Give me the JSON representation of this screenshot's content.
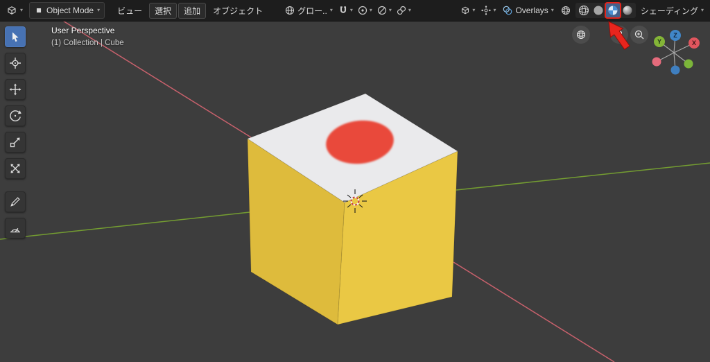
{
  "header": {
    "mode_label": "Object Mode",
    "menus": {
      "view": "ビュー",
      "select": "選択",
      "add": "追加",
      "object": "オブジェクト"
    },
    "orientation_label": "グロー..",
    "overlays_label": "Overlays",
    "shading_label": "シェーディング"
  },
  "viewport": {
    "view_label": "User Perspective",
    "collection_label": "(1) Collection | Cube",
    "axis_labels": {
      "x": "X",
      "y": "Y",
      "z": "Z"
    }
  },
  "tools": [
    "select-box",
    "cursor",
    "move",
    "rotate",
    "scale",
    "transform",
    "annotate",
    "measure"
  ],
  "icons": {
    "chevron": "▾",
    "editor_type": "3d-viewport-cube",
    "snapping": "magnet",
    "proportional": "circle-dot",
    "falloff": "slashed-circle",
    "link": "chain-link",
    "overlays": "overlapping-circles",
    "nav": [
      "sphere-grid",
      "hand",
      "magnifier-plus"
    ]
  },
  "colors": {
    "header_bg": "#1d1d1d",
    "viewport_bg": "#3d3d3d",
    "active_tool_blue": "#4772b3",
    "cube_top": "#eaeaec",
    "cube_left": "#debb3c",
    "cube_right": "#eac844",
    "flag_red": "#e94a3b",
    "axis_x_pink": "#d0636f",
    "axis_y_green": "#77a331",
    "gizmo_x_red": "#e0565e",
    "gizmo_y_green": "#84b537",
    "gizmo_z_blue": "#4086c8",
    "gizmo_x_neg": "#e56b7c",
    "gizmo_y_neg": "#7cb53a",
    "gizmo_z_neg": "#3f7fc0",
    "annotation_red": "#e8251d"
  }
}
